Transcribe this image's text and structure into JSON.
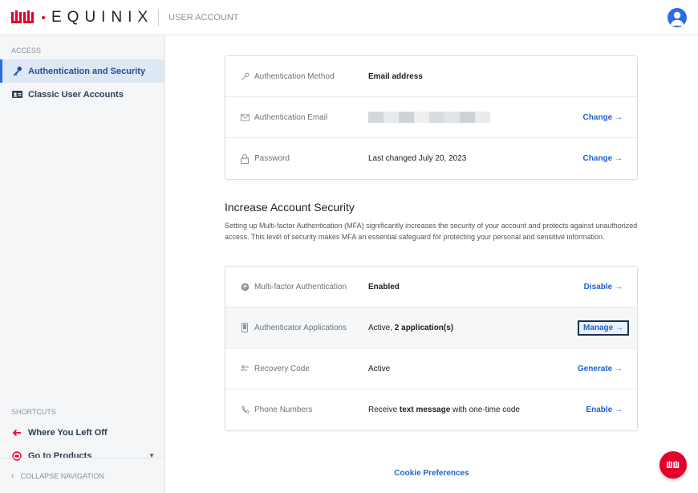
{
  "header": {
    "logo_text": "EQUINIX",
    "app_name": "USER ACCOUNT",
    "brand_color": "#e4002b",
    "avatar_icon": "user-avatar-icon"
  },
  "sidebar": {
    "section_label": "ACCESS",
    "items": [
      {
        "label": "Authentication and Security",
        "icon": "key-icon",
        "active": true
      },
      {
        "label": "Classic User Accounts",
        "icon": "id-card-icon",
        "active": false
      }
    ],
    "shortcuts_label": "SHORTCUTS",
    "shortcuts": [
      {
        "label": "Where You Left Off",
        "icon": "arrow-left-icon"
      },
      {
        "label": "Go to Products",
        "icon": "products-icon"
      }
    ],
    "collapse_label": "COLLAPSE NAVIGATION"
  },
  "auth_card": {
    "rows": [
      {
        "key": "Authentication Method",
        "icon": "key-outline-icon",
        "value": "Email address",
        "action": ""
      },
      {
        "key": "Authentication Email",
        "icon": "envelope-icon",
        "value": "",
        "action": "Change →"
      },
      {
        "key": "Password",
        "icon": "lock-icon",
        "value": "Last changed July 20, 2023",
        "action": "Change →"
      }
    ]
  },
  "security": {
    "title": "Increase Account Security",
    "description": "Setting up Multi-factor Authentication (MFA) significantly increases the security of your account and protects against unauthorized access. This level of security makes MFA an essential safeguard for protecting your personal and sensitive information.",
    "rows": [
      {
        "key": "Multi-factor Authentication",
        "icon": "fingerprint-icon",
        "value_pre": "Enabled",
        "value_bold": "",
        "value_post": "",
        "action": "Disable →"
      },
      {
        "key": "Authenticator Applications",
        "icon": "phone-icon",
        "value_pre": "Active, ",
        "value_bold": "2 application(s)",
        "value_post": "",
        "action": "Manage →"
      },
      {
        "key": "Recovery Code",
        "icon": "key-return-icon",
        "value_pre": "Active",
        "value_bold": "",
        "value_post": "",
        "action": "Generate →"
      },
      {
        "key": "Phone Numbers",
        "icon": "handset-icon",
        "value_pre": "Receive ",
        "value_bold": "text message",
        "value_post": " with one-time code",
        "action": "Enable →"
      }
    ]
  },
  "footer": {
    "cookie_link": "Cookie Preferences"
  }
}
